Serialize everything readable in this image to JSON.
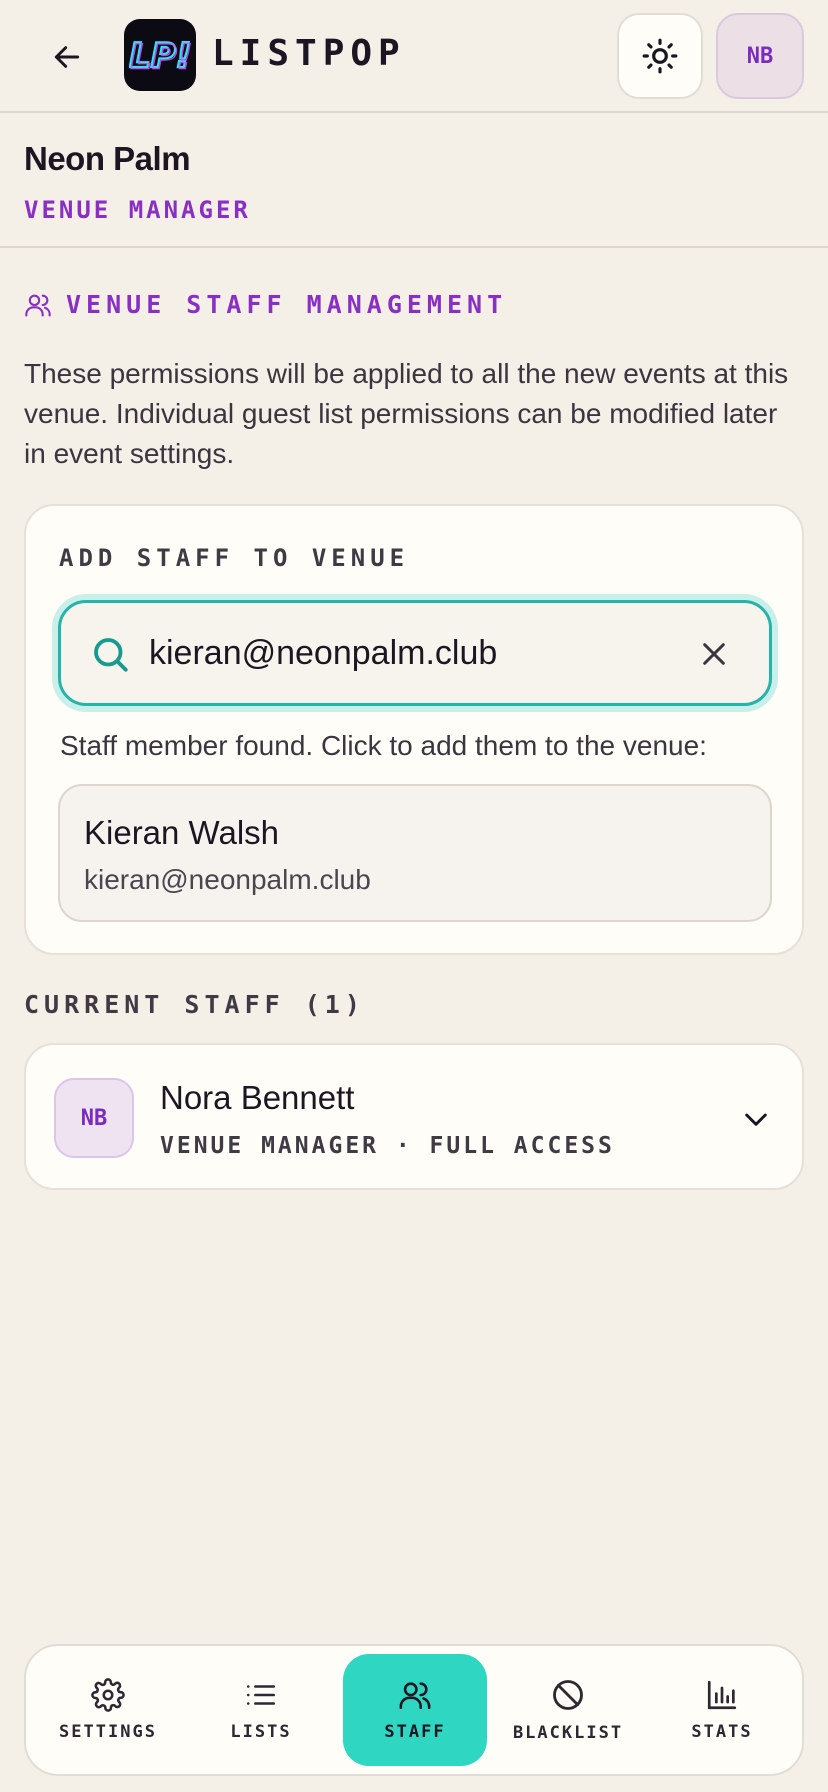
{
  "header": {
    "brand": "LISTPOP",
    "logo_text": "LP!",
    "user_initials": "NB"
  },
  "venue": {
    "name": "Neon Palm",
    "role": "VENUE MANAGER"
  },
  "section": {
    "title": "VENUE STAFF MANAGEMENT",
    "description": "These permissions will be applied to all the new events at this venue. Individual guest list permissions can be modified later in event settings."
  },
  "add_staff": {
    "title": "ADD STAFF TO VENUE",
    "search_value": "kieran@neonpalm.club",
    "found_message": "Staff member found. Click to add them to the venue:",
    "result": {
      "name": "Kieran Walsh",
      "email": "kieran@neonpalm.club"
    }
  },
  "current_staff": {
    "title": "CURRENT STAFF (1)",
    "members": [
      {
        "initials": "NB",
        "name": "Nora Bennett",
        "role": "VENUE MANAGER · FULL ACCESS"
      }
    ]
  },
  "nav": {
    "items": [
      {
        "label": "SETTINGS",
        "icon": "gear-icon"
      },
      {
        "label": "LISTS",
        "icon": "list-icon"
      },
      {
        "label": "STAFF",
        "icon": "users-icon",
        "active": true
      },
      {
        "label": "BLACKLIST",
        "icon": "ban-icon"
      },
      {
        "label": "STATS",
        "icon": "bar-chart-icon"
      }
    ]
  },
  "colors": {
    "accent_purple": "#8a2fc6",
    "accent_teal": "#2fd6c1",
    "background": "#f4efe7"
  }
}
